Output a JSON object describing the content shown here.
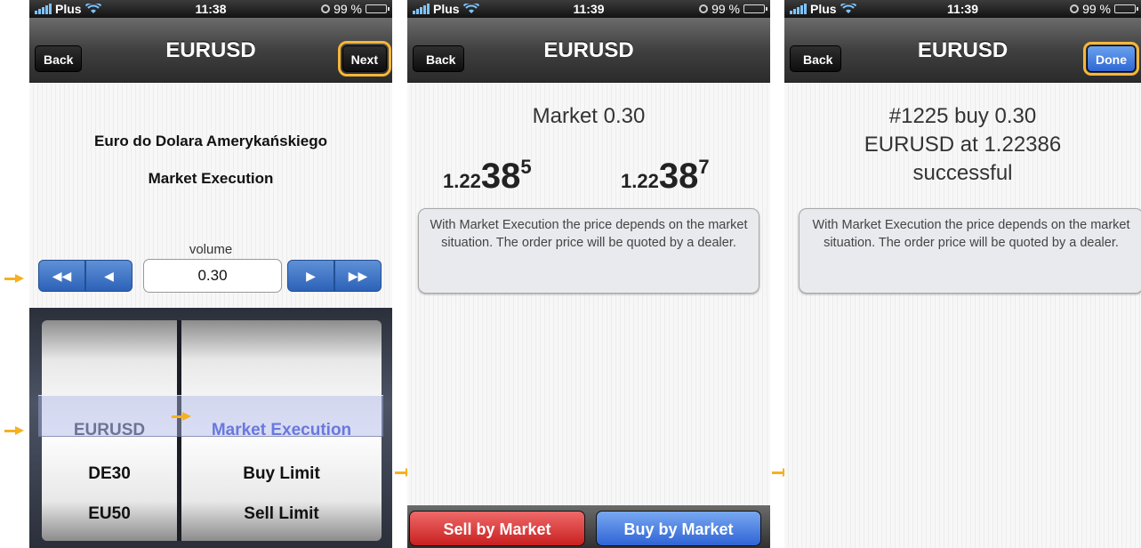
{
  "status": {
    "carrier": "Plus",
    "battery": "99 %",
    "times": [
      "11:38",
      "11:39",
      "11:39"
    ]
  },
  "screen1": {
    "nav_title": "EURUSD",
    "back_label": "Back",
    "next_label": "Next",
    "instrument_name": "Euro do Dolara Amerykańskiego",
    "execution_mode": "Market Execution",
    "volume_label": "volume",
    "volume_value": "0.30",
    "picker_left": [
      "EURUSD",
      "DE30",
      "EU50"
    ],
    "picker_right": [
      "Market Execution",
      "Buy Limit",
      "Sell Limit"
    ]
  },
  "screen2": {
    "nav_title": "EURUSD",
    "back_label": "Back",
    "order_title": "Market 0.30",
    "bid_prefix": "1.22",
    "bid_big": "38",
    "bid_sup": "5",
    "ask_prefix": "1.22",
    "ask_big": "38",
    "ask_sup": "7",
    "info_text": "With Market Execution the price depends on the market situation. The order price will be quoted by a dealer.",
    "sell_label": "Sell by Market",
    "buy_label": "Buy by Market"
  },
  "screen3": {
    "nav_title": "EURUSD",
    "back_label": "Back",
    "done_label": "Done",
    "result_line1": "#1225 buy 0.30",
    "result_line2": "EURUSD at 1.22386",
    "result_line3": "successful",
    "info_text": "With Market Execution the price depends on the market situation. The order price will be quoted by a dealer."
  },
  "colors": {
    "highlight": "#f6b63a",
    "accent_blue": "#2f64d6",
    "sell_red": "#c81f1f"
  }
}
